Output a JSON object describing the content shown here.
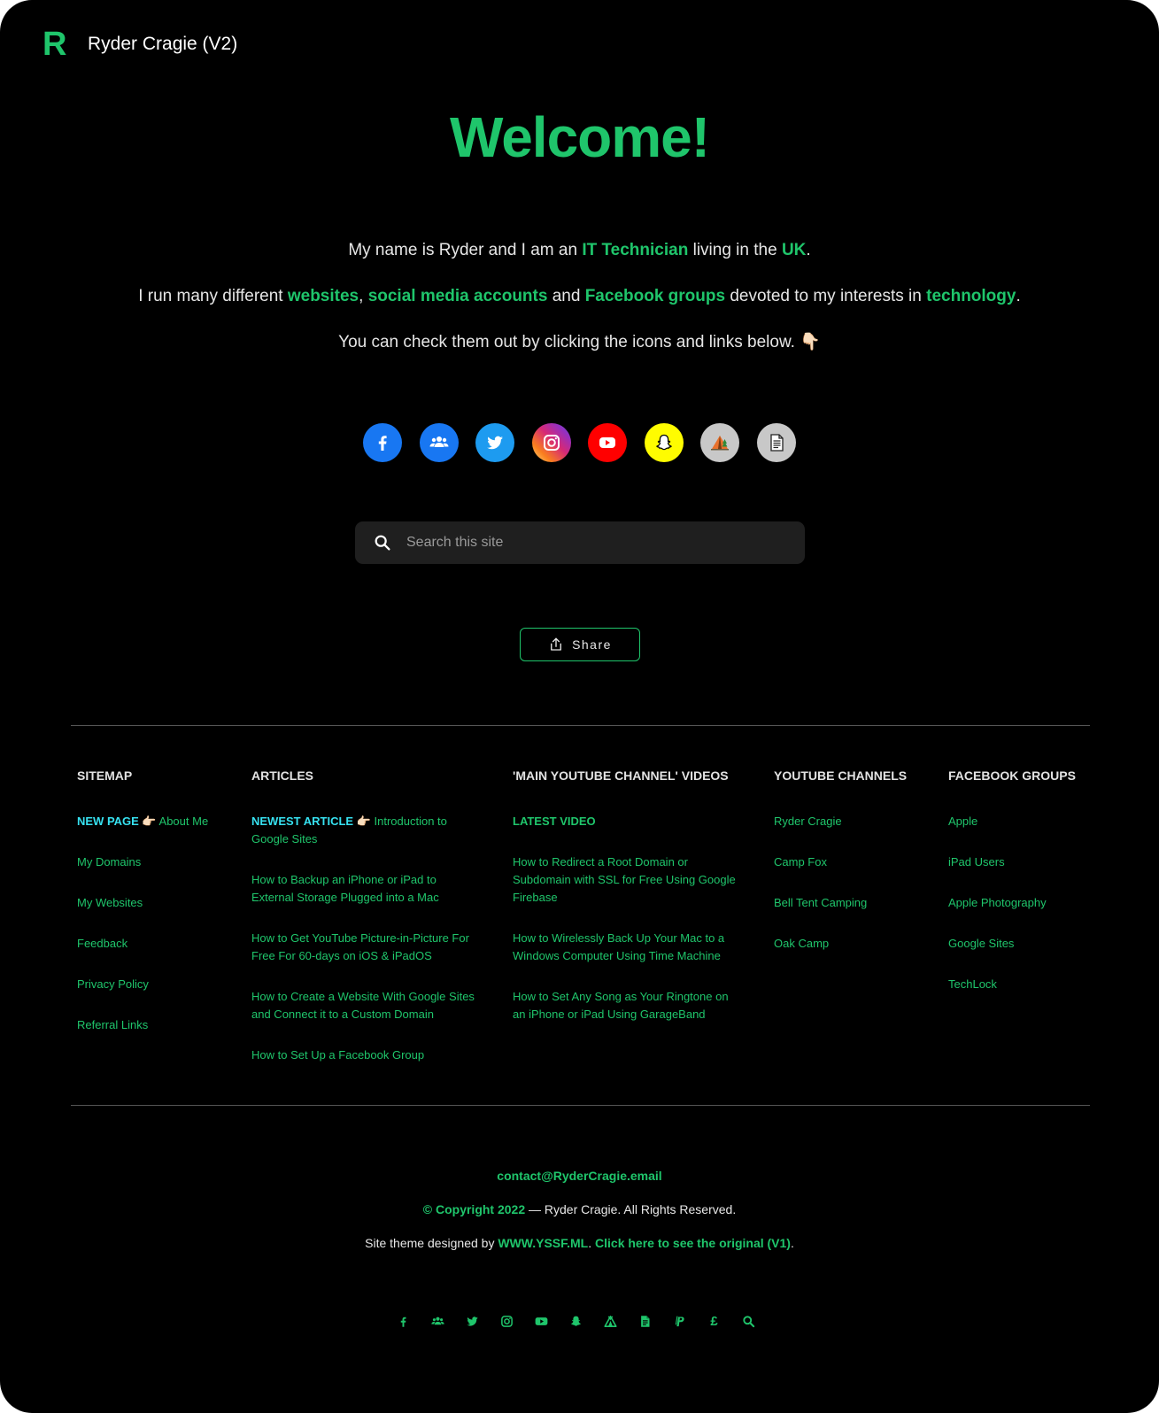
{
  "header": {
    "logo_letter": "R",
    "site_title": "Ryder Cragie (V2)"
  },
  "welcome": "Welcome!",
  "intro": {
    "line1": {
      "a": "My name is Ryder and I am an ",
      "link1": "IT Technician",
      "b": " living in the ",
      "link2": "UK",
      "c": "."
    },
    "line2": {
      "a": "I run many different ",
      "link1": "websites",
      "b": ", ",
      "link2": "social media accounts",
      "c": " and ",
      "link3": "Facebook groups",
      "d": " devoted to my interests in ",
      "link4": "technology",
      "e": "."
    },
    "line3": {
      "text": "You can check them out by clicking the icons and links below.",
      "emoji": "👇🏻"
    }
  },
  "socials": [
    {
      "name": "facebook-icon",
      "color": "#1877f2"
    },
    {
      "name": "facebook-groups-icon",
      "color": "#1877f2"
    },
    {
      "name": "twitter-icon",
      "color": "#1d9bf0"
    },
    {
      "name": "instagram-icon",
      "color": "#d62976"
    },
    {
      "name": "youtube-icon",
      "color": "#ff0000"
    },
    {
      "name": "snapchat-icon",
      "color": "#fffc00"
    },
    {
      "name": "camping-tent-icon",
      "color": "#c8c8c8"
    },
    {
      "name": "document-icon",
      "color": "#c8c8c8"
    }
  ],
  "search": {
    "placeholder": "Search this site"
  },
  "share": {
    "label": "Share"
  },
  "footer_columns": {
    "sitemap": {
      "title": "SITEMAP",
      "highlight": "NEW PAGE 👉🏻",
      "items": [
        "About Me",
        "My Domains",
        "My Websites",
        "Feedback",
        "Privacy Policy",
        "Referral Links"
      ]
    },
    "articles": {
      "title": "ARTICLES",
      "highlight": "NEWEST ARTICLE 👉🏻",
      "items": [
        "Introduction to Google Sites",
        "How to Backup an iPhone or iPad to External Storage Plugged into a Mac",
        "How to Get YouTube Picture-in-Picture For Free For 60-days on iOS & iPadOS",
        "How to Create a Website With Google Sites and Connect it to a Custom Domain",
        "How to Set Up a Facebook Group"
      ]
    },
    "videos": {
      "title": "'MAIN YOUTUBE CHANNEL' VIDEOS",
      "highlight": "LATEST VIDEO",
      "items": [
        "How to Redirect a Root Domain or Subdomain with SSL for Free Using Google Firebase",
        "How to Wirelessly Back Up Your Mac to a Windows Computer Using Time Machine",
        "How to Set Any Song as Your Ringtone on an iPhone or iPad Using GarageBand"
      ]
    },
    "channels": {
      "title": "YOUTUBE CHANNELS",
      "items": [
        "Ryder Cragie",
        "Camp Fox",
        "Bell Tent Camping",
        "Oak Camp"
      ]
    },
    "groups": {
      "title": "FACEBOOK GROUPS",
      "items": [
        "Apple",
        "iPad Users",
        "Apple Photography",
        "Google Sites",
        "TechLock"
      ]
    }
  },
  "footer": {
    "email": "contact@RyderCragie.email",
    "copyright_link": "© Copyright 2022",
    "copyright_rest": " — Ryder Cragie. All Rights Reserved.",
    "theme_prefix": "Site theme designed by ",
    "theme_link": "WWW.YSSF.ML",
    "theme_mid": ". ",
    "theme_link2": "Click here to see the original (V1)",
    "theme_end": "."
  },
  "mini_icons": [
    "facebook-icon",
    "facebook-groups-icon",
    "twitter-icon",
    "instagram-icon",
    "youtube-icon",
    "snapchat-icon",
    "tent-icon",
    "document-icon",
    "paypal-icon",
    "pound-icon",
    "search-icon"
  ],
  "colors": {
    "accent": "#1fc56b",
    "highlight": "#36e1f0",
    "background": "#000000"
  }
}
